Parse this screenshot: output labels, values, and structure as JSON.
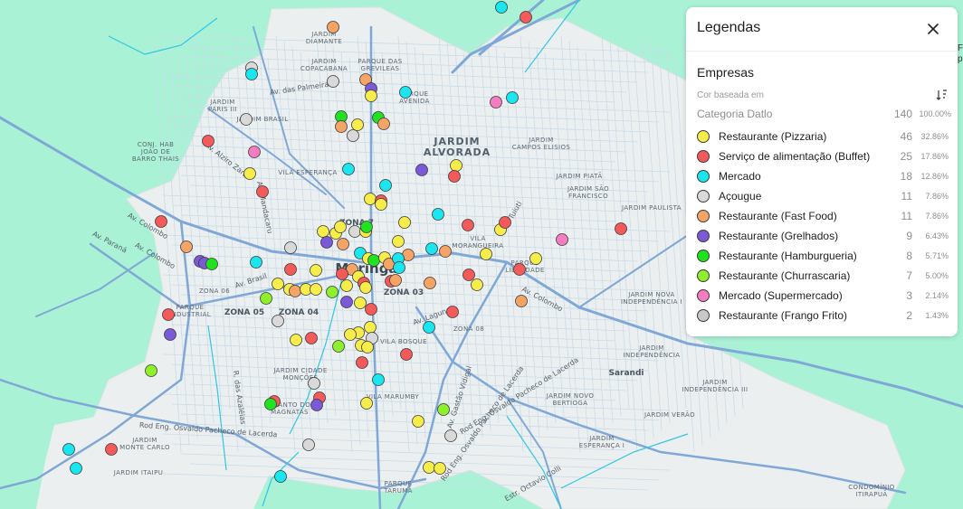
{
  "map": {
    "city_label": "Maringá",
    "area_labels": [
      {
        "text": "JARDIM DIAMANTE",
        "lines": [
          "JARDIM",
          "DIAMANTE"
        ]
      },
      {
        "text": "JARDIM COPACABANA",
        "lines": [
          "JARDIM",
          "COPACABANA"
        ]
      },
      {
        "text": "PARQUE DAS GREVILEAS",
        "lines": [
          "PARQUE DAS",
          "GREVILEAS"
        ]
      },
      {
        "text": "PARQUE AVENIDA",
        "lines": [
          "PARQUE",
          "AVENIDA"
        ]
      },
      {
        "text": "JARDIM PARIS III",
        "lines": [
          "JARDIM",
          "PARIS III"
        ]
      },
      {
        "text": "JARDIM BRASIL",
        "lines": [
          "JARDIM BRASIL"
        ]
      },
      {
        "text": "CONJ. HAB JOÃO DE BARRO THAIS",
        "lines": [
          "CONJ. HAB",
          "JOÃO DE",
          "BARRO THAIS"
        ]
      },
      {
        "text": "VILA ESPERANÇA",
        "lines": [
          "VILA ESPERANÇA"
        ]
      },
      {
        "text": "JARDIM ALVORADA",
        "lines": [
          "JARDIM",
          "ALVORADA"
        ]
      },
      {
        "text": "JARDIM CAMPOS ELISIOS",
        "lines": [
          "JARDIM",
          "CAMPOS ELISIOS"
        ]
      },
      {
        "text": "JARDIM PIATÃ",
        "lines": [
          "JARDIM PIATÃ"
        ]
      },
      {
        "text": "JARDIM SÃO FRANCISCO",
        "lines": [
          "JARDIM SÃO",
          "FRANCISCO"
        ]
      },
      {
        "text": "JARDIM PAULISTA",
        "lines": [
          "JARDIM PAULISTA"
        ]
      },
      {
        "text": "ZONA 7",
        "lines": [
          "ZONA 7"
        ]
      },
      {
        "text": "VILA MORANGUEIRA",
        "lines": [
          "VILA",
          "MORANGUEIRA"
        ]
      },
      {
        "text": "PARQUE LIBERDADE",
        "lines": [
          "PARQUE",
          "LIBERDADE"
        ]
      },
      {
        "text": "ZONA 06",
        "lines": [
          "ZONA 06"
        ]
      },
      {
        "text": "ZONA 05",
        "lines": [
          "ZONA 05"
        ]
      },
      {
        "text": "ZONA 04",
        "lines": [
          "ZONA 04"
        ]
      },
      {
        "text": "ZONA 03",
        "lines": [
          "ZONA 03"
        ]
      },
      {
        "text": "ZONA 08",
        "lines": [
          "ZONA 08"
        ]
      },
      {
        "text": "PARQUE INDUSTRIAL",
        "lines": [
          "PARQUE",
          "INDUSTRIAL"
        ]
      },
      {
        "text": "VILA BOSQUE",
        "lines": [
          "VILA BOSQUE"
        ]
      },
      {
        "text": "JARDIM NOVA INDEPENDÊNCIA I",
        "lines": [
          "JARDIM NOVA",
          "INDEPENDÊNCIA I"
        ]
      },
      {
        "text": "JARDIM INDEPENDÊNCIA",
        "lines": [
          "JARDIM",
          "INDEPENDÊNCIA"
        ]
      },
      {
        "text": "Sarandi",
        "lines": [
          "Sarandi"
        ]
      },
      {
        "text": "JARDIM INDEPENDÊNCIA III",
        "lines": [
          "JARDIM",
          "INDEPENDÊNCIA III"
        ]
      },
      {
        "text": "JARDIM CIDADE MONÇÕES",
        "lines": [
          "JARDIM CIDADE",
          "MONÇÕES"
        ]
      },
      {
        "text": "VILA MARUMBY",
        "lines": [
          "VILA MARUMBY"
        ]
      },
      {
        "text": "RECANTO DOS MAGNATAS",
        "lines": [
          "RECANTO DOS",
          "MAGNATAS"
        ]
      },
      {
        "text": "JARDIM NOVO BERTIOGA",
        "lines": [
          "JARDIM NOVO",
          "BERTIOGA"
        ]
      },
      {
        "text": "JARDIM VERÃO",
        "lines": [
          "JARDIM VERÃO"
        ]
      },
      {
        "text": "JARDIM ESPERANÇA I",
        "lines": [
          "JARDIM",
          "ESPERANÇA I"
        ]
      },
      {
        "text": "JARDIM MONTE CARLO",
        "lines": [
          "JARDIM",
          "MONTE CARLO"
        ]
      },
      {
        "text": "JARDIM ITAIPU",
        "lines": [
          "JARDIM ITAIPU"
        ]
      },
      {
        "text": "PARQUE TARUMÃ",
        "lines": [
          "PARQUE",
          "TARUMÃ"
        ]
      },
      {
        "text": "CONDOMÍNIO ITIRAPUÃ",
        "lines": [
          "CONDOMÍNIO",
          "ITIRAPUÃ"
        ]
      }
    ],
    "street_labels": [
      "Av. das Palmeiras",
      "Av. Alziro Zarur",
      "Av. Mandacaru",
      "Av. Colombo",
      "Av. Colombo",
      "Av. Paraná",
      "Av. Brasil",
      "Av. Laguna",
      "Av. Colombo",
      "Av. Tuiuti",
      "R. das Azaléias",
      "Av. Gastão Vidigal",
      "Rod Eng. Osvaldo Pacheco de Lacerda",
      "Rod Eng. Osvaldo Pacheco de Lacerda",
      "Estr. Octavio Colli",
      "Rod Eng. Osvaldo Pacheco de Lacerda"
    ]
  },
  "legend": {
    "title": "Legendas",
    "close_icon": "close-icon",
    "layer_name": "Empresas",
    "color_based_label": "Cor baseada em",
    "sort_icon": "sort-descending-icon",
    "category_field": "Categoria Datlo",
    "total_count": "140",
    "total_pct": "100.00%",
    "items": [
      {
        "label": "Restaurante (Pizzaria)",
        "count": "46",
        "pct": "32.86%",
        "color": "#f6ec4a"
      },
      {
        "label": "Serviço de alimentação (Buffet)",
        "count": "25",
        "pct": "17.86%",
        "color": "#f45a5a"
      },
      {
        "label": "Mercado",
        "count": "18",
        "pct": "12.86%",
        "color": "#19e6ef"
      },
      {
        "label": "Açougue",
        "count": "11",
        "pct": "7.86%",
        "color": "#d9d9d9"
      },
      {
        "label": "Restaurante (Fast Food)",
        "count": "11",
        "pct": "7.86%",
        "color": "#f6a465"
      },
      {
        "label": "Restaurante (Grelhados)",
        "count": "9",
        "pct": "6.43%",
        "color": "#7a5ad6"
      },
      {
        "label": "Restaurante (Hamburgueria)",
        "count": "8",
        "pct": "5.71%",
        "color": "#1ee31e"
      },
      {
        "label": "Restaurante (Churrascaria)",
        "count": "7",
        "pct": "5.00%",
        "color": "#8ef02c"
      },
      {
        "label": "Mercado (Supermercado)",
        "count": "3",
        "pct": "2.14%",
        "color": "#f57cc0"
      },
      {
        "label": "Restaurante (Frango Frito)",
        "count": "2",
        "pct": "1.43%",
        "color": "#c8c8c8"
      }
    ]
  },
  "edge_text": "Fe\np"
}
